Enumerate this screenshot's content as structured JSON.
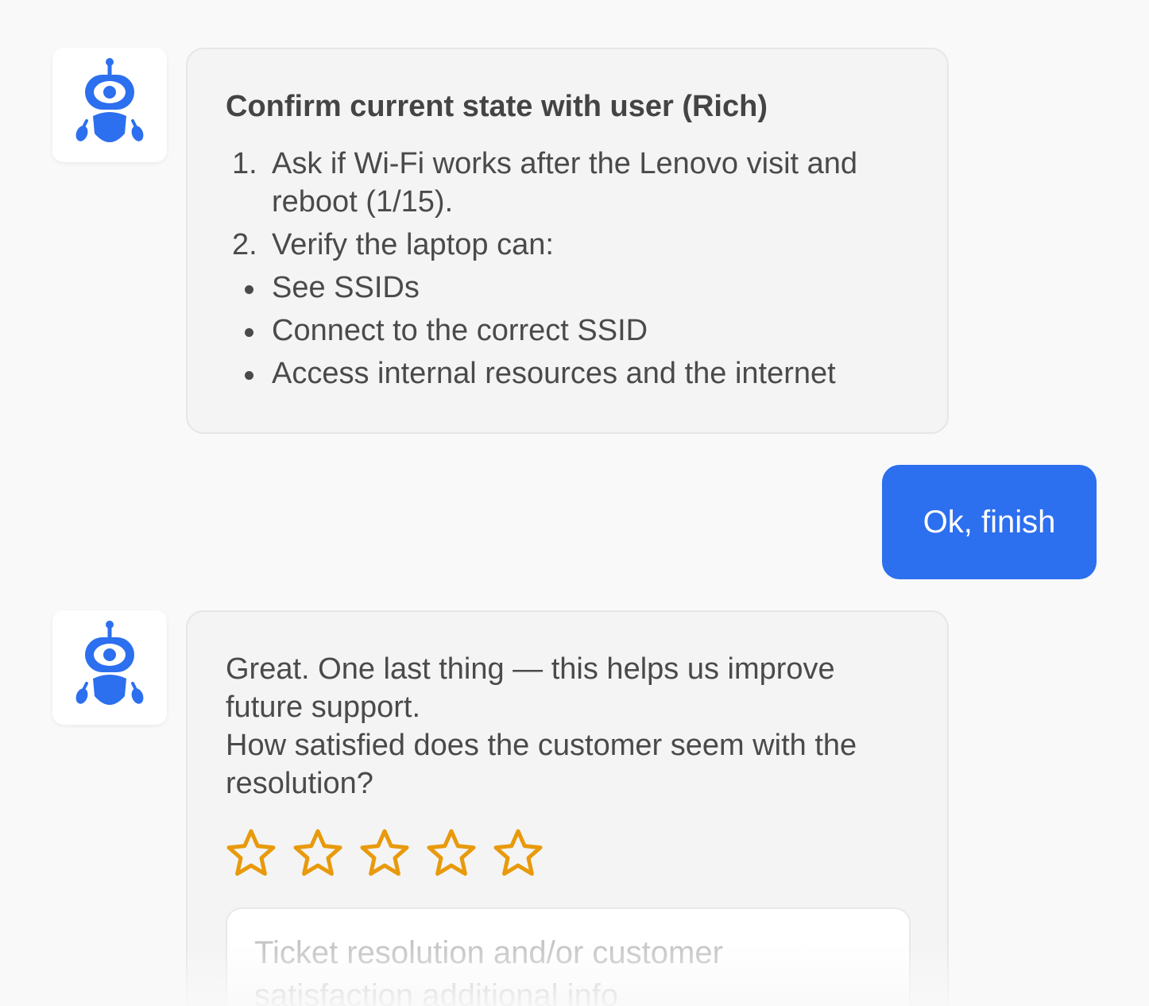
{
  "colors": {
    "accent": "#2c6fef",
    "star": "#e89a0c",
    "bot_bubble_bg": "#f4f4f4",
    "page_bg": "#f9f9f9"
  },
  "messages": [
    {
      "sender": "bot",
      "avatar_icon": "robot-icon",
      "title": "Confirm current state with user (Rich)",
      "ordered": [
        {
          "num": "1.",
          "text": "Ask if Wi-Fi works after the Lenovo visit and reboot (1/15)."
        },
        {
          "num": "2.",
          "text": "Verify the laptop can:"
        }
      ],
      "bullets": [
        "See SSIDs",
        "Connect to the correct SSID",
        "Access internal resources and the internet"
      ]
    },
    {
      "sender": "user",
      "text": "Ok, finish"
    },
    {
      "sender": "bot",
      "avatar_icon": "robot-icon",
      "paragraph1": "Great. One last thing — this helps us improve future support.",
      "paragraph2": "How satisfied does the customer seem with the resolution?",
      "rating": {
        "max": 5,
        "selected": 0,
        "icon": "star-outline-icon"
      },
      "notes_placeholder": "Ticket resolution and/or customer satisfaction additional info",
      "notes_value": ""
    }
  ]
}
